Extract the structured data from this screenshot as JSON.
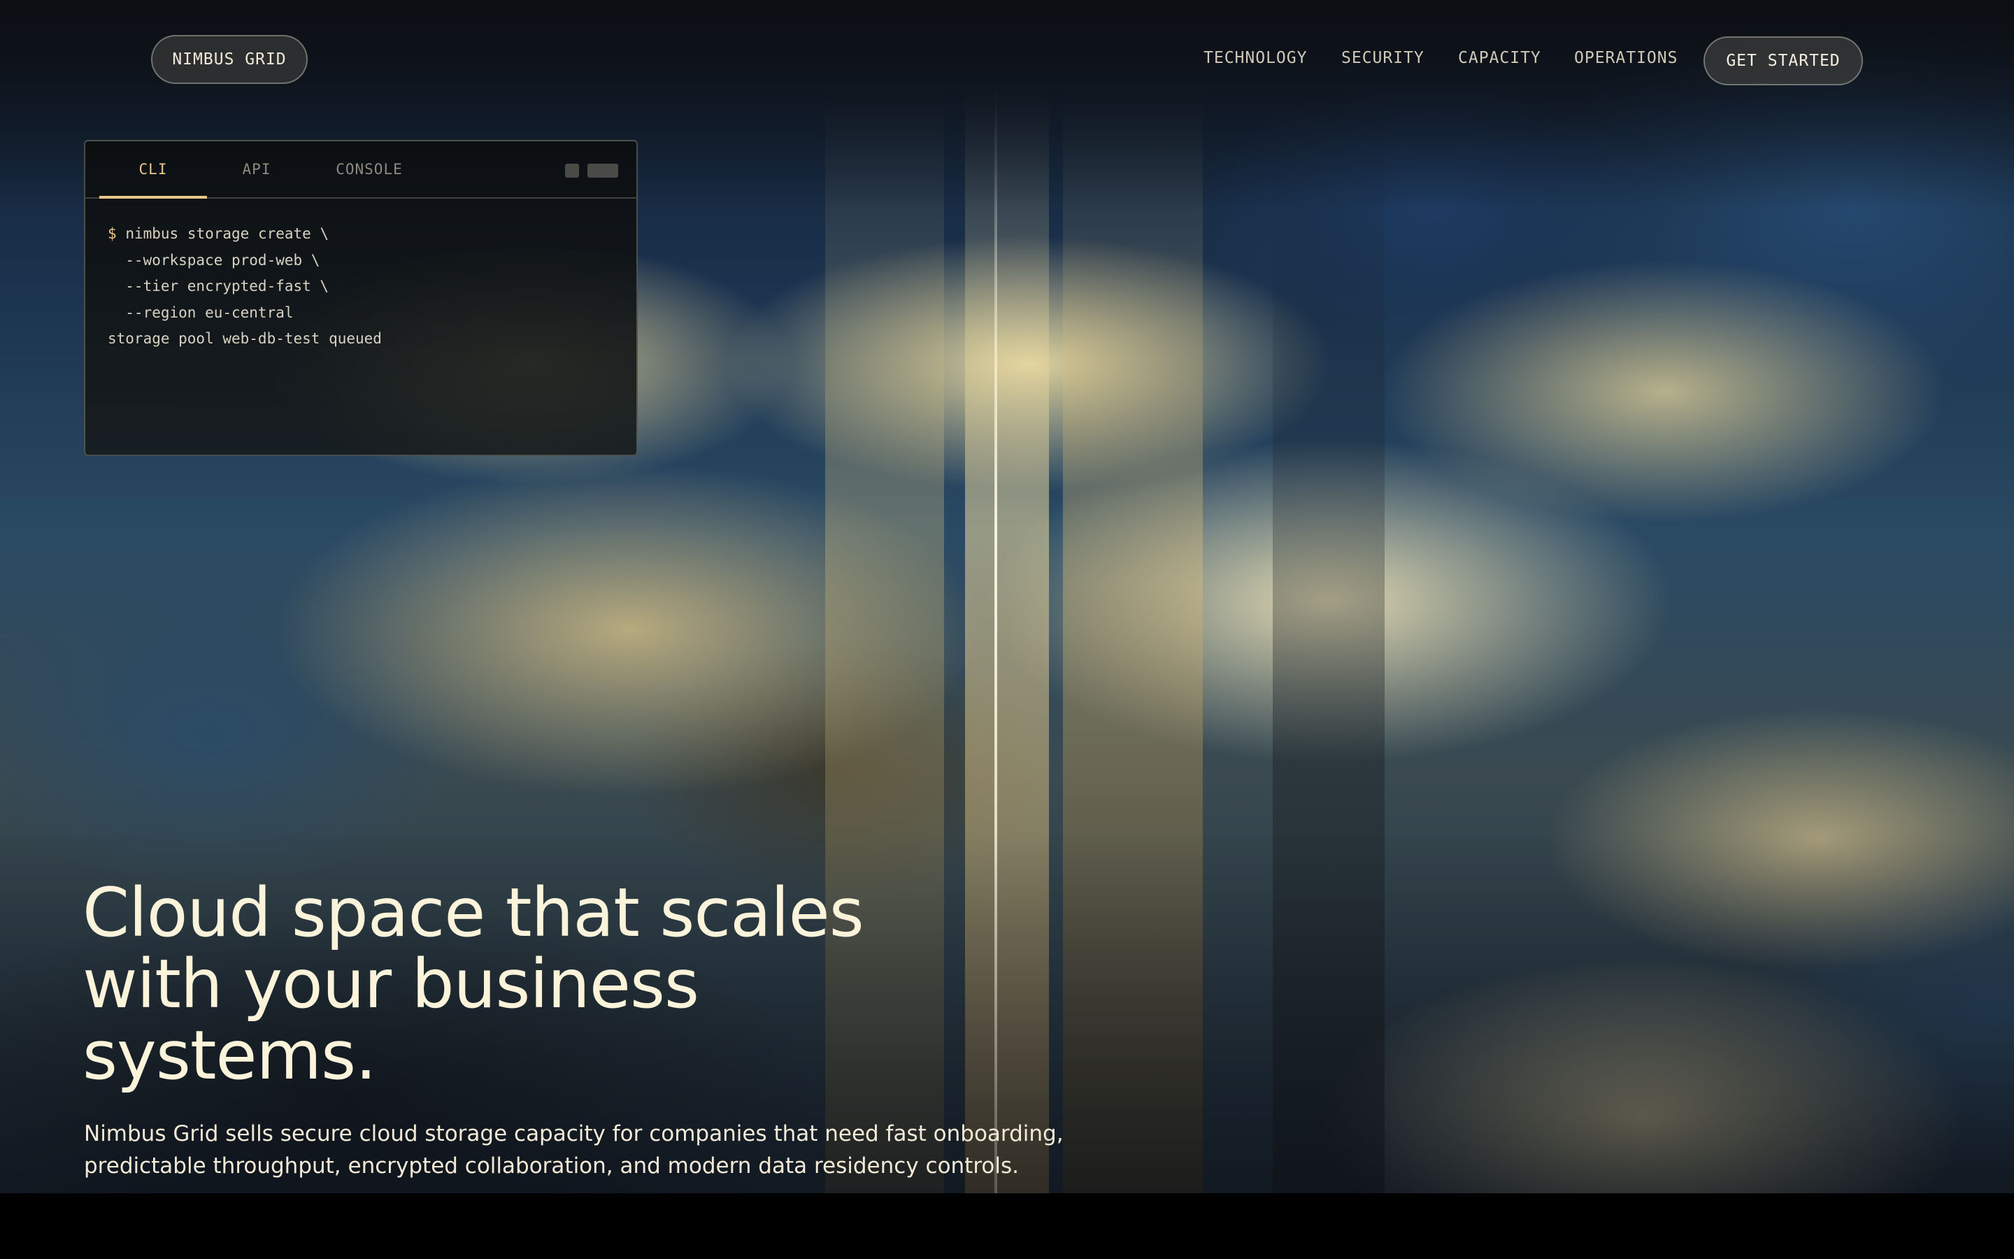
{
  "brand": {
    "name": "NIMBUS GRID"
  },
  "nav": {
    "links": [
      "TECHNOLOGY",
      "SECURITY",
      "CAPACITY",
      "OPERATIONS"
    ],
    "cta_label": "GET STARTED"
  },
  "terminal": {
    "tabs": [
      "CLI",
      "API",
      "CONSOLE"
    ],
    "active_tab": "CLI",
    "prompt_symbol": "$",
    "lines": [
      "nimbus storage create \\",
      "  --workspace prod-web \\",
      "  --tier encrypted-fast \\",
      "  --region eu-central",
      "storage pool web-db-test queued"
    ]
  },
  "hero": {
    "headline_lines": [
      "Cloud space that scales",
      "with your business",
      "systems."
    ],
    "subtitle_lines": [
      "Nimbus Grid sells secure cloud storage capacity for companies that need fast onboarding,",
      "predictable throughput, encrypted collaboration, and modern data residency controls."
    ]
  },
  "colors": {
    "accent": "#e8c98a",
    "headline": "#fbf3da",
    "footer_band": "#000000"
  }
}
